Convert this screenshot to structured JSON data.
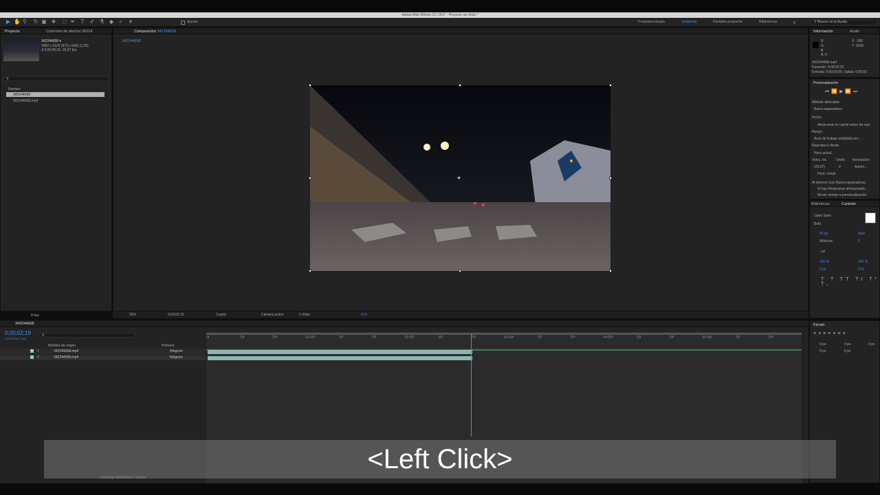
{
  "window": {
    "title": "Adobe After Effects CC 2017 - Proyecto sin título *"
  },
  "toolbar": {
    "snap_label": "Ajustar",
    "workspaces": [
      "Predeterminado",
      "Estándar",
      "Pantalla pequeña",
      "Bibliotecas"
    ],
    "active_workspace": "Estándar",
    "search_placeholder": "Buscar en la Ayuda"
  },
  "project_panel": {
    "tabs": [
      "Proyecto",
      "Controles de efectos 34224"
    ],
    "selected_name": "342244658 ▾",
    "selected_info_1": "3492 x 2160 (873 x 540) (1,00)",
    "selected_info_2": "Δ 0;00;05;29, 29,97 fps",
    "column_name": "Nombre",
    "items": [
      "342244658",
      "342244658.mp4"
    ],
    "bpc": "8 bpc"
  },
  "composition_panel": {
    "tab_label": "Composición",
    "tab_comp": "342244658",
    "comp_tab": "342244658",
    "zoom": "25%",
    "timecode": "0;00;02;19",
    "resolution": "Cuarto",
    "camera": "Cámara activa",
    "views": "1 Vista",
    "exposure": "+0,0"
  },
  "info_panel": {
    "tabs": [
      "Información",
      "Audio"
    ],
    "r": "R:",
    "g": "G:",
    "b": "B:",
    "a": "A: 0",
    "x": "X: -280",
    "y": "Y: 2508",
    "file": "342244658.mp4",
    "duration": "Duración: 0;00;02;20",
    "in_out": "Entrada: 0;00;00;00, Salida: 0;00;02;"
  },
  "preview_panel": {
    "title": "Previsualización",
    "shortcut_label": "Método abreviado",
    "shortcut_value": "Barra espaciadora",
    "include": "Incluir:",
    "cache_before": "Almacenar en caché antes de repr",
    "range_label": "Rango",
    "range_value": "Área de trabajo ampliada por...",
    "play_from_label": "Reproducir desde",
    "play_from_value": "Hora actual",
    "frame_rate_label": "Veloc. fot.",
    "skip_label": "Omitir",
    "resolution_label": "Resolución",
    "frame_rate_value": "(29,97)",
    "skip_value": "0",
    "resolution_value": "Autom...",
    "fullscreen": "Pant. compl.",
    "on_stop_label": "Al detener (con Barra espaciadora):",
    "if_cached": "Si hay fotogramas almacenado...",
    "move_time": "Mover tiempo a previsualización"
  },
  "character_panel": {
    "tabs": [
      "Bibliotecas",
      "Carácter"
    ],
    "font": "Open Sans",
    "style": "Bold",
    "size": "60 px",
    "leading": "Auto",
    "metrics": "Métricas",
    "tracking": "0",
    "stroke_unit": "- px",
    "vscale": "100 %",
    "hscale": "100 %",
    "baseline": "0 px",
    "tsume": "0 %"
  },
  "paragraph_panel": {
    "title": "Párrafo",
    "indents": [
      "0 px",
      "0 px",
      "0 px",
      "0 px",
      "0 px"
    ]
  },
  "timeline": {
    "comp_tab": "342244658",
    "timecode": "0;00;02;19",
    "frames": "00079 (29.97 fps)",
    "column_source": "Nombre de origen",
    "column_parent": "Primario",
    "layers": [
      {
        "num": "1",
        "name": "342244658.mp4",
        "parent": "Ninguno"
      },
      {
        "num": "2",
        "name": "342244658.mp4",
        "parent": "Ninguno"
      }
    ],
    "ruler": [
      "0f",
      "10f",
      "20f",
      "01:00f",
      "10f",
      "20f",
      "02:00f",
      "10f",
      "20f",
      "03:00f",
      "10f",
      "20f",
      "04:00f",
      "10f",
      "20f",
      "05:00f",
      "10f",
      "20f"
    ],
    "playhead_fraction": 0.445,
    "layer_bar_end_fraction": 0.445,
    "footer": "Conmutar definidores / modos"
  },
  "caption": "<Left Click>",
  "colors": {
    "accent": "#3f8ff0",
    "panel": "#232323",
    "layer_bar": "#8fb6b0",
    "work_area": "#2e8a4a"
  }
}
